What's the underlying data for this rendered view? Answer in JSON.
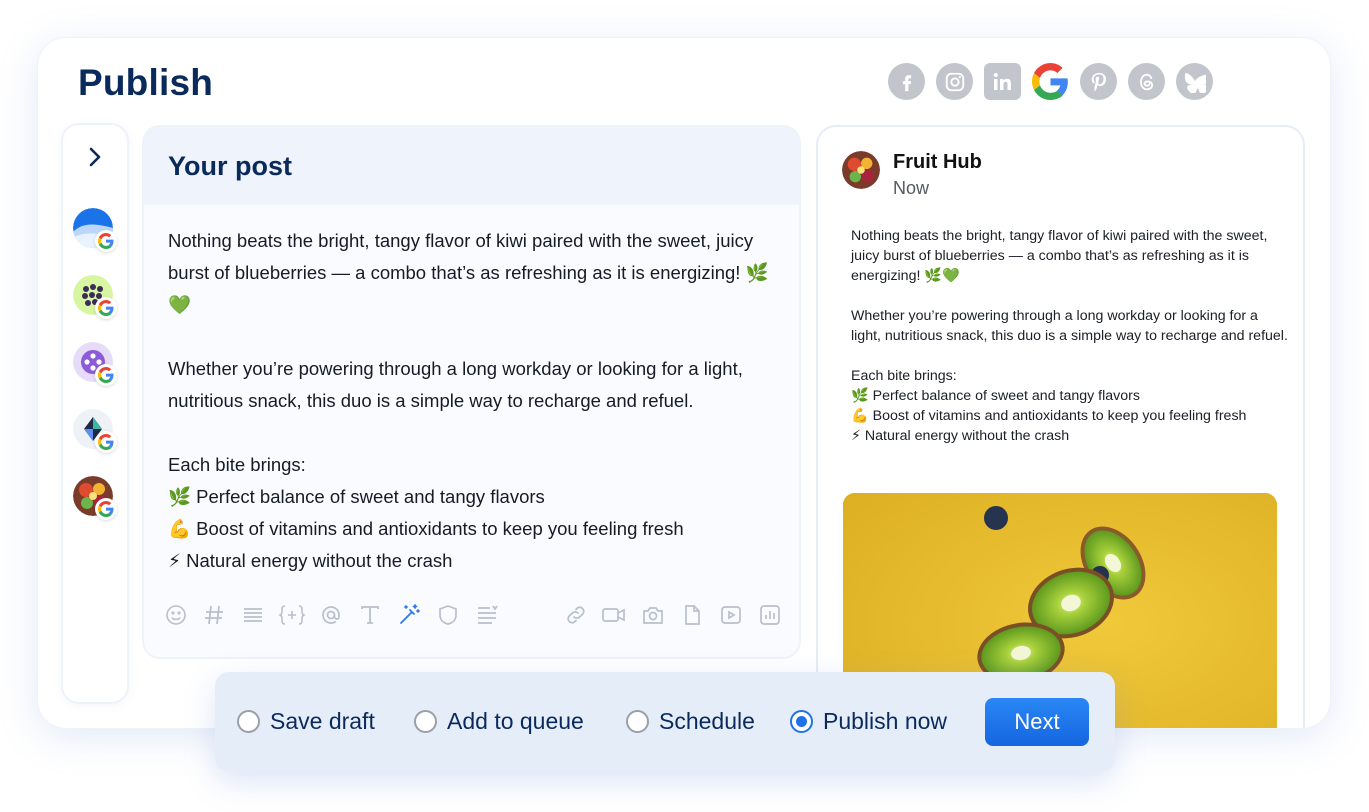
{
  "page": {
    "title": "Publish"
  },
  "networks": [
    {
      "icon": "facebook-icon",
      "active": false
    },
    {
      "icon": "instagram-icon",
      "active": false
    },
    {
      "icon": "linkedin-icon",
      "active": false
    },
    {
      "icon": "google-icon",
      "active": true
    },
    {
      "icon": "pinterest-icon",
      "active": false
    },
    {
      "icon": "threads-icon",
      "active": false
    },
    {
      "icon": "bluesky-icon",
      "active": false
    }
  ],
  "accounts": [
    {
      "icon": "wave-logo-icon",
      "network": "google-icon"
    },
    {
      "icon": "dots-logo-icon",
      "network": "google-icon"
    },
    {
      "icon": "purple-logo-icon",
      "network": "google-icon"
    },
    {
      "icon": "leaf-logo-icon",
      "network": "google-icon"
    },
    {
      "icon": "fruit-avatar-icon",
      "network": "google-icon"
    }
  ],
  "editor": {
    "title": "Your post",
    "content": "Nothing beats the bright, tangy flavor of kiwi paired with the sweet, juicy burst of blueberries — a combo that’s as refreshing as it is energizing! 🌿💚\n\nWhether you’re powering through a long workday or looking for a light, nutritious snack, this duo is a simple way to recharge and refuel.\n\nEach bite brings:\n🌿 Perfect balance of sweet and tangy flavors\n💪 Boost of vitamins and antioxidants to keep you feeling fresh\n⚡ Natural energy without the crash",
    "tools": [
      "emoji-icon",
      "hashtag-icon",
      "text-format-icon",
      "variables-icon",
      "mention-icon",
      "font-icon",
      "ai-magic-wand-icon",
      "shield-icon",
      "text-align-icon",
      "link-icon",
      "video-icon",
      "camera-icon",
      "document-icon",
      "video-play-icon",
      "chart-icon"
    ]
  },
  "preview": {
    "account_name": "Fruit Hub",
    "time": "Now",
    "content": "Nothing beats the bright, tangy flavor of kiwi paired with the sweet, juicy burst of blueberries — a combo that’s as refreshing as it is energizing! 🌿💚\n\nWhether you’re powering through a long workday or looking for a light, nutritious snack, this duo is a simple way to recharge and refuel.\n\nEach bite brings:\n🌿 Perfect balance of sweet and tangy flavors\n💪 Boost of vitamins and antioxidants to keep you feeling fresh\n⚡ Natural energy without the crash",
    "image": "kiwi-blueberry-photo"
  },
  "actions": {
    "options": [
      {
        "label": "Save draft",
        "selected": false
      },
      {
        "label": "Add to queue",
        "selected": false
      },
      {
        "label": "Schedule",
        "selected": false
      },
      {
        "label": "Publish now",
        "selected": true
      }
    ],
    "next_label": "Next"
  },
  "colors": {
    "accent": "#1e73e8",
    "title": "#0b2a5c",
    "image_bg": "#e7bd32"
  }
}
